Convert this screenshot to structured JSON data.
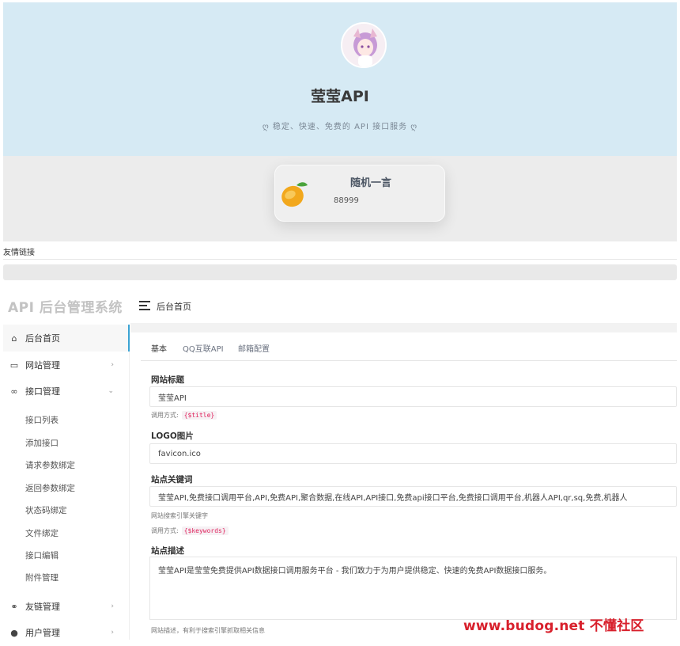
{
  "site": {
    "title": "莹莹API",
    "subtitle": "ღ 稳定、快速、免费的 API 接口服务 ღ",
    "quote_title": "随机一言",
    "quote_text": "88999",
    "friend_links": "友情链接"
  },
  "admin": {
    "system_title": "API 后台管理系统",
    "header_title": "后台首页",
    "sidebar": {
      "home": "后台首页",
      "site_manage": "网站管理",
      "api_manage": "接口管理",
      "sub_items": [
        "接口列表",
        "添加接口",
        "请求参数绑定",
        "返回参数绑定",
        "状态码绑定",
        "文件绑定",
        "接口编辑",
        "附件管理"
      ],
      "link_manage": "友链管理",
      "user_manage": "用户管理"
    },
    "tabs": [
      "基本",
      "QQ互联API",
      "邮箱配置"
    ],
    "form": {
      "site_title_label": "网站标题",
      "site_title_value": "莹莹API",
      "site_title_hint": "调用方式:",
      "site_title_code": "{$title}",
      "logo_label": "LOGO图片",
      "logo_value": "favicon.ico",
      "keywords_label": "站点关键词",
      "keywords_value": "莹莹API,免费接口调用平台,API,免费API,聚合数据,在线API,API接口,免费api接口平台,免费接口调用平台,机器人API,qr,sq,免费,机器人",
      "keywords_hint": "网站搜索引擎关键字",
      "keywords_hint2": "调用方式:",
      "keywords_code": "{$keywords}",
      "desc_label": "站点描述",
      "desc_value": "莹莹API是莹莹免费提供API数据接口调用服务平台 - 我们致力于为用户提供稳定、快速的免费API数据接口服务。",
      "desc_hint": "网站描述，有利于搜索引擎抓取相关信息"
    }
  },
  "watermark": "www.budog.net 不懂社区",
  "colors": {
    "hero_bg": "#d6eaf4",
    "accent": "#3ba3d3",
    "code_red": "#e0245e",
    "watermark_red": "#d8202c"
  }
}
